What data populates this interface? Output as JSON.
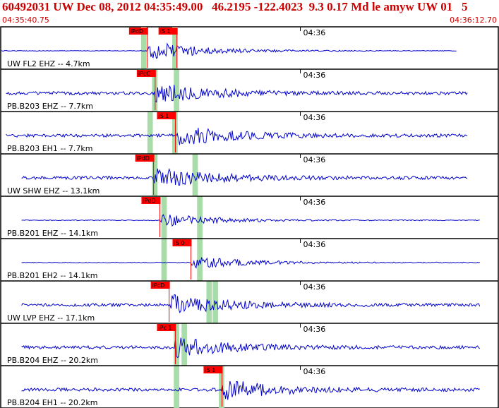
{
  "header": {
    "title": "60492031 UW Dec 08, 2012 04:35:49.00   46.2195 -122.4023  9.3 0.17 Md le amyw UW 01   5",
    "start_time": "04:35:40.75",
    "end_time": "04:36:12.70"
  },
  "colors": {
    "header_text": "#cc0000",
    "trace": "#0000cc",
    "pick": "#ff0000",
    "pick_window": "#a8dca8",
    "border": "#000000"
  },
  "chart_data": {
    "type": "line",
    "x_unit": "time",
    "xlim": [
      "04:35:40.75",
      "04:36:12.70"
    ],
    "minute_tick_label": "04:36",
    "traces": [
      {
        "label": "UW FL2 EHZ -- 4.7km",
        "picks": [
          {
            "label": "iPdD",
            "t": 9.4
          },
          {
            "label": "iS 1",
            "t": 11.3
          }
        ],
        "windows": [
          9.0,
          11.0
        ]
      },
      {
        "label": "PB.B203 EHZ -- 7.7km",
        "picks": [
          {
            "label": "iPcC",
            "t": 9.9
          }
        ],
        "windows": [
          9.7,
          11.1
        ]
      },
      {
        "label": "PB.B203 EH1 -- 7.7km",
        "picks": [
          {
            "label": "iS 1",
            "t": 11.2
          }
        ],
        "windows": [
          9.4,
          11.0
        ]
      },
      {
        "label": "UW SHW EHZ -- 13.1km",
        "picks": [
          {
            "label": "iPdD",
            "t": 9.8
          }
        ],
        "windows": [
          9.7,
          12.3
        ]
      },
      {
        "label": "PB.B201 EHZ -- 14.1km",
        "picks": [
          {
            "label": "iPdD",
            "t": 10.2
          }
        ],
        "windows": [
          10.3,
          12.6
        ]
      },
      {
        "label": "PB.B201 EH2 -- 14.1km",
        "picks": [
          {
            "label": "iS 0",
            "t": 12.2
          }
        ],
        "windows": [
          10.3,
          12.6
        ]
      },
      {
        "label": "UW LVP EHZ -- 17.1km",
        "picks": [
          {
            "label": "iPcD",
            "t": 10.8
          }
        ],
        "windows": [
          13.2,
          13.6
        ]
      },
      {
        "label": "PB.B204 EHZ -- 20.2km",
        "picks": [
          {
            "label": "iPc 1",
            "t": 11.2
          }
        ],
        "windows": [
          11.1,
          11.6
        ]
      },
      {
        "label": "PB.B204 EH1 -- 20.2km",
        "picks": [
          {
            "label": "iS 1",
            "t": 14.2
          }
        ],
        "windows": [
          11.1,
          14.0
        ]
      }
    ]
  }
}
